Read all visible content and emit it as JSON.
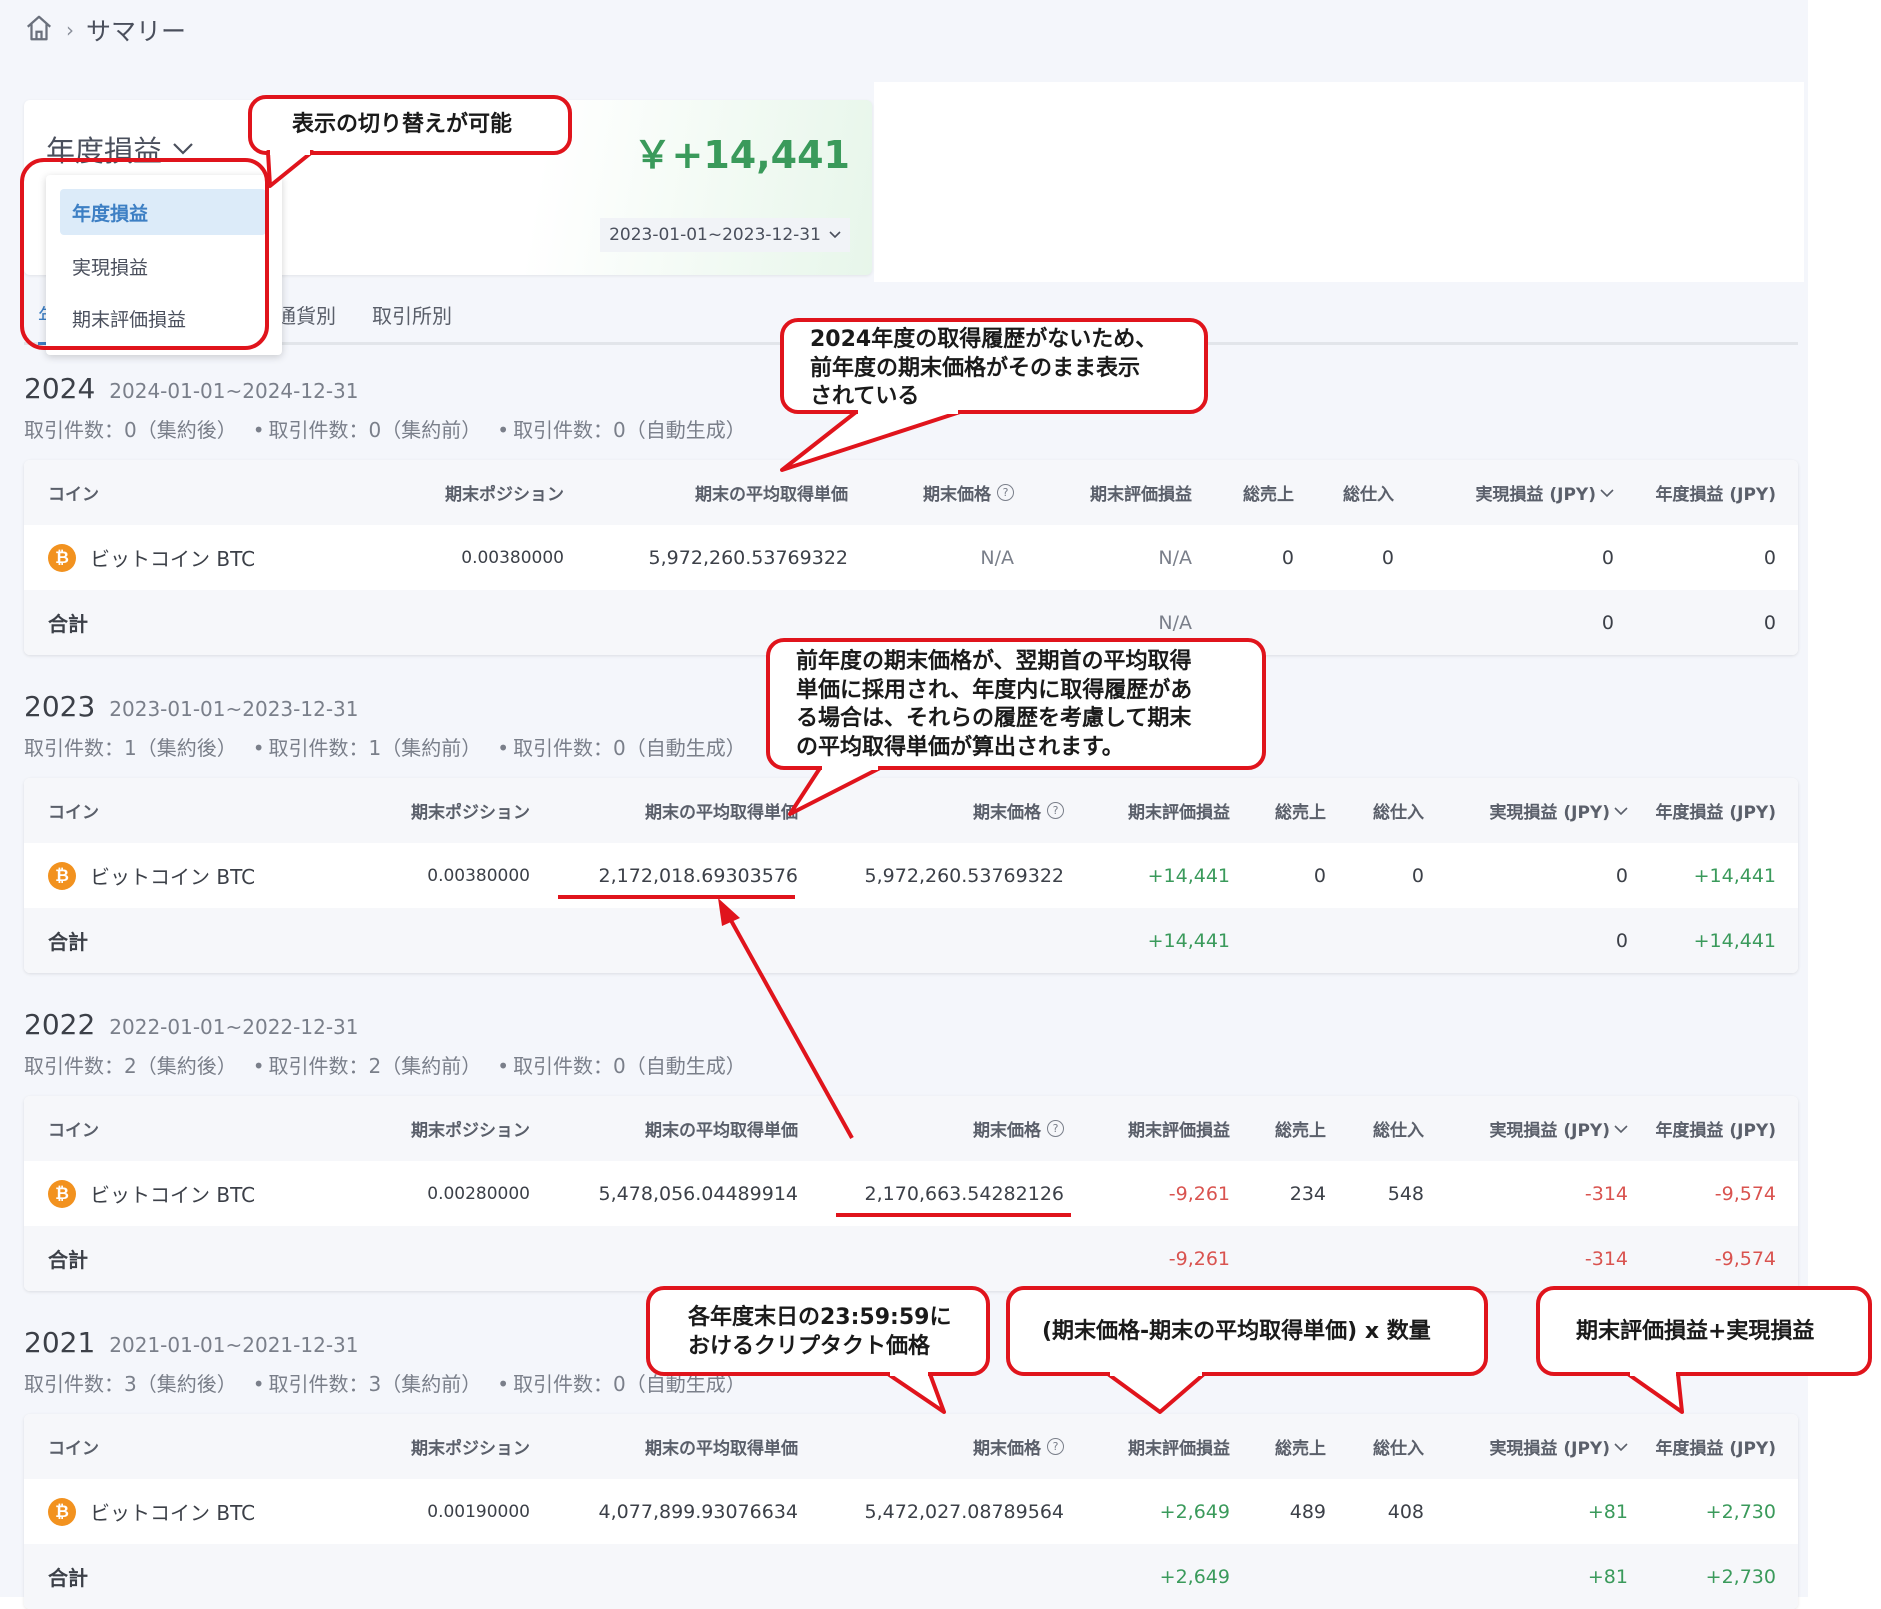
{
  "breadcrumb": {
    "current": "サマリー"
  },
  "summary": {
    "type_selected": "年度損益",
    "total": "￥+14,441",
    "period": "2023-01-01~2023-12-31",
    "dropdown_options": [
      "年度損益",
      "実現損益",
      "期末評価損益"
    ]
  },
  "tabs": [
    "年",
    "通貨別",
    "取引所別"
  ],
  "columns": {
    "coin": "コイン",
    "position": "期末ポジション",
    "avg_cost": "期末の平均取得単価",
    "end_price": "期末価格",
    "eval_pl": "期末評価損益",
    "sales": "総売上",
    "purchase": "総仕入",
    "realized": "実現損益 (JPY)",
    "annual": "年度損益 (JPY)"
  },
  "total_label": "合計",
  "coin_name": "ビットコイン BTC",
  "years": [
    {
      "year": "2024",
      "range": "2024-01-01~2024-12-31",
      "counts": [
        "取引件数：0（集約後）",
        "取引件数：0（集約前）",
        "取引件数：0（自動生成）"
      ],
      "row": {
        "position": "0.00380000",
        "avg_cost": "5,972,260.53769322",
        "end_price": "N/A",
        "eval_pl": "N/A",
        "sales": "0",
        "purchase": "0",
        "realized": "0",
        "annual": "0"
      },
      "total": {
        "eval_pl": "N/A",
        "realized": "0",
        "annual": "0"
      }
    },
    {
      "year": "2023",
      "range": "2023-01-01~2023-12-31",
      "counts": [
        "取引件数：1（集約後）",
        "取引件数：1（集約前）",
        "取引件数：0（自動生成）"
      ],
      "row": {
        "position": "0.00380000",
        "avg_cost": "2,172,018.69303576",
        "end_price": "5,972,260.53769322",
        "eval_pl": "+14,441",
        "sales": "0",
        "purchase": "0",
        "realized": "0",
        "annual": "+14,441"
      },
      "total": {
        "eval_pl": "+14,441",
        "realized": "0",
        "annual": "+14,441"
      }
    },
    {
      "year": "2022",
      "range": "2022-01-01~2022-12-31",
      "counts": [
        "取引件数：2（集約後）",
        "取引件数：2（集約前）",
        "取引件数：0（自動生成）"
      ],
      "row": {
        "position": "0.00280000",
        "avg_cost": "5,478,056.04489914",
        "end_price": "2,170,663.54282126",
        "eval_pl": "-9,261",
        "sales": "234",
        "purchase": "548",
        "realized": "-314",
        "annual": "-9,574"
      },
      "total": {
        "eval_pl": "-9,261",
        "realized": "-314",
        "annual": "-9,574"
      }
    },
    {
      "year": "2021",
      "range": "2021-01-01~2021-12-31",
      "counts": [
        "取引件数：3（集約後）",
        "取引件数：3（集約前）",
        "取引件数：0（自動生成）"
      ],
      "row": {
        "position": "0.00190000",
        "avg_cost": "4,077,899.93076634",
        "end_price": "5,472,027.08789564",
        "eval_pl": "+2,649",
        "sales": "489",
        "purchase": "408",
        "realized": "+81",
        "annual": "+2,730"
      },
      "total": {
        "eval_pl": "+2,649",
        "realized": "+81",
        "annual": "+2,730"
      }
    }
  ],
  "callouts": {
    "switch": "表示の切り替えが可能",
    "no_history": [
      "2024年度の取得履歴がないため、",
      "前年度の期末価格がそのまま表示",
      "されている"
    ],
    "carryover": [
      "前年度の期末価格が、翌期首の平均取得",
      "単価に採用され、年度内に取得履歴があ",
      "る場合は、それらの履歴を考慮して期末",
      "の平均取得単価が算出されます。"
    ],
    "price_time": [
      "各年度末日の23:59:59に",
      "おけるクリプタクト価格"
    ],
    "eval_formula": "(期末価格-期末の平均取得単価) x 数量",
    "annual_formula": "期末評価損益+実現損益"
  },
  "colors": {
    "positive": "#3a9a5b",
    "negative": "#d9534f",
    "accent": "#3d7fc4",
    "annotation": "#e0141c",
    "btc": "#f2921f"
  },
  "icons": {
    "home": "home-icon",
    "btc": "bitcoin-icon",
    "help": "help-icon",
    "chevron": "chevron-down-icon"
  }
}
